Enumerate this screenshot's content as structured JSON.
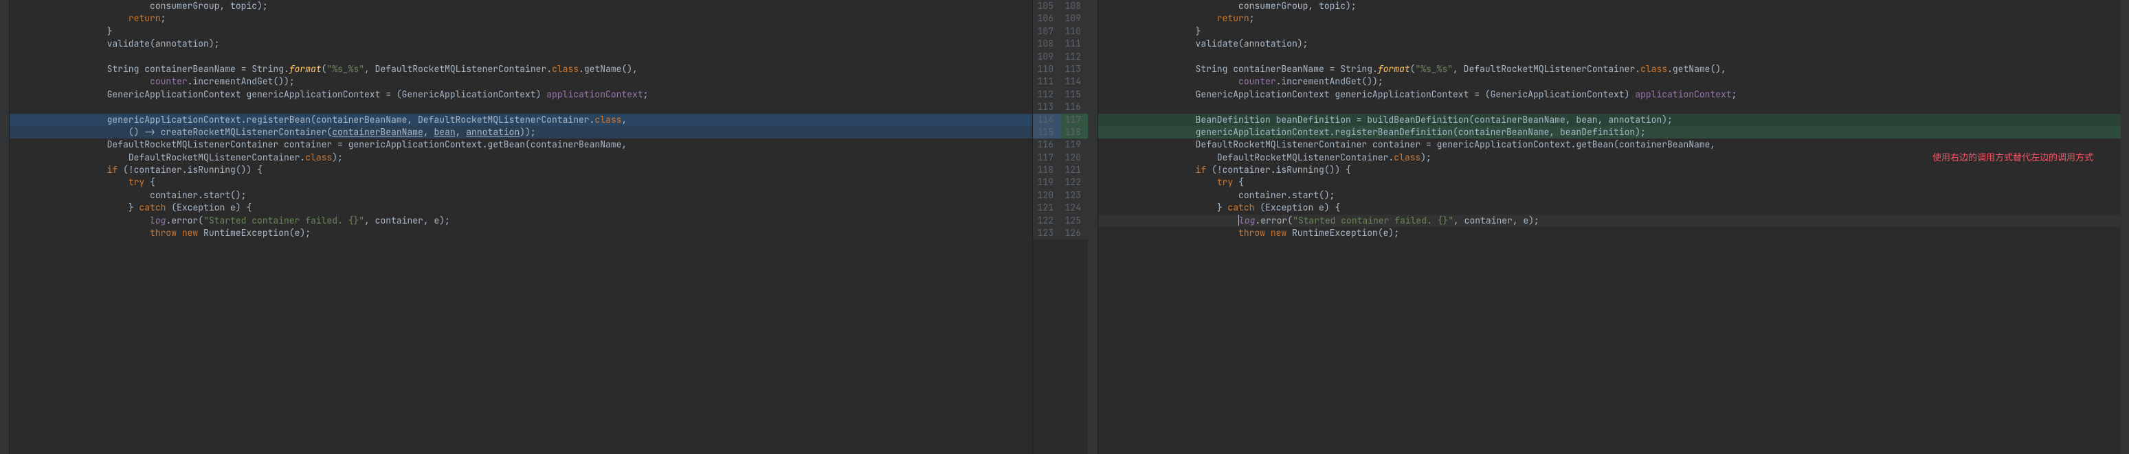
{
  "left": {
    "lines": [
      {
        "num": "",
        "indent": 5,
        "tokens": [
          {
            "t": "consumerGroup",
            "c": "param"
          },
          {
            "t": ", ",
            "c": ""
          },
          {
            "t": "topic",
            "c": "param"
          },
          {
            "t": ");",
            "c": ""
          }
        ]
      },
      {
        "num": "",
        "indent": 4,
        "tokens": [
          {
            "t": "return",
            "c": "kw"
          },
          {
            "t": ";",
            "c": ""
          }
        ]
      },
      {
        "num": "",
        "indent": 3,
        "tokens": [
          {
            "t": "}",
            "c": ""
          }
        ]
      },
      {
        "num": "",
        "indent": 3,
        "tokens": [
          {
            "t": "validate(annotation);",
            "c": ""
          }
        ]
      },
      {
        "num": "",
        "indent": 0,
        "tokens": []
      },
      {
        "num": "",
        "indent": 3,
        "tokens": [
          {
            "t": "String containerBeanName = String.",
            "c": ""
          },
          {
            "t": "format",
            "c": "method-italic"
          },
          {
            "t": "(",
            "c": ""
          },
          {
            "t": "\"%s_%s\"",
            "c": "str"
          },
          {
            "t": ", DefaultRocketMQListenerContainer.",
            "c": ""
          },
          {
            "t": "class",
            "c": "kw"
          },
          {
            "t": ".getName(),",
            "c": ""
          }
        ]
      },
      {
        "num": "",
        "indent": 5,
        "tokens": [
          {
            "t": "counter",
            "c": "field"
          },
          {
            "t": ".incrementAndGet());",
            "c": ""
          }
        ]
      },
      {
        "num": "",
        "indent": 3,
        "tokens": [
          {
            "t": "GenericApplicationContext genericApplicationContext = (GenericApplicationContext) ",
            "c": ""
          },
          {
            "t": "applicationContext",
            "c": "field"
          },
          {
            "t": ";",
            "c": ""
          }
        ]
      },
      {
        "num": "",
        "indent": 0,
        "tokens": []
      },
      {
        "num": "",
        "indent": 3,
        "hl": "blue",
        "tokens": [
          {
            "t": "genericApplicationContext.registerBean(containerBeanName, DefaultRocketMQListenerContainer.",
            "c": ""
          },
          {
            "t": "class",
            "c": "kw"
          },
          {
            "t": ",",
            "c": ""
          }
        ]
      },
      {
        "num": "",
        "indent": 4,
        "hl": "blue-dark",
        "tokens": [
          {
            "t": "() -> createRocketMQListenerContainer(",
            "c": ""
          },
          {
            "t": "containerBeanName",
            "c": "underline"
          },
          {
            "t": ", ",
            "c": ""
          },
          {
            "t": "bean",
            "c": "underline"
          },
          {
            "t": ", ",
            "c": ""
          },
          {
            "t": "annotation",
            "c": "underline"
          },
          {
            "t": "));",
            "c": ""
          }
        ]
      },
      {
        "num": "",
        "indent": 3,
        "tokens": [
          {
            "t": "DefaultRocketMQListenerContainer container = genericApplicationContext.getBean(containerBeanName,",
            "c": ""
          }
        ]
      },
      {
        "num": "",
        "indent": 4,
        "tokens": [
          {
            "t": "DefaultRocketMQListenerContainer.",
            "c": ""
          },
          {
            "t": "class",
            "c": "kw"
          },
          {
            "t": ");",
            "c": ""
          }
        ]
      },
      {
        "num": "",
        "indent": 3,
        "tokens": [
          {
            "t": "if",
            "c": "kw"
          },
          {
            "t": " (!container.isRunning()) {",
            "c": ""
          }
        ]
      },
      {
        "num": "",
        "indent": 4,
        "tokens": [
          {
            "t": "try",
            "c": "kw"
          },
          {
            "t": " {",
            "c": ""
          }
        ]
      },
      {
        "num": "",
        "indent": 5,
        "tokens": [
          {
            "t": "container.start();",
            "c": ""
          }
        ]
      },
      {
        "num": "",
        "indent": 4,
        "tokens": [
          {
            "t": "} ",
            "c": ""
          },
          {
            "t": "catch",
            "c": "kw"
          },
          {
            "t": " (Exception e) {",
            "c": ""
          }
        ]
      },
      {
        "num": "",
        "indent": 5,
        "tokens": [
          {
            "t": "log",
            "c": "field-italic"
          },
          {
            "t": ".error(",
            "c": ""
          },
          {
            "t": "\"Started container failed. {}\"",
            "c": "str"
          },
          {
            "t": ", container, e);",
            "c": ""
          }
        ]
      },
      {
        "num": "",
        "indent": 5,
        "tokens": [
          {
            "t": "throw new",
            "c": "kw"
          },
          {
            "t": " RuntimeException(e);",
            "c": ""
          }
        ]
      }
    ]
  },
  "right": {
    "lines": [
      {
        "indent": 5,
        "tokens": [
          {
            "t": "consumerGroup",
            "c": "param"
          },
          {
            "t": ", ",
            "c": ""
          },
          {
            "t": "topic",
            "c": "param"
          },
          {
            "t": ");",
            "c": ""
          }
        ]
      },
      {
        "indent": 4,
        "tokens": [
          {
            "t": "return",
            "c": "kw"
          },
          {
            "t": ";",
            "c": ""
          }
        ]
      },
      {
        "indent": 3,
        "tokens": [
          {
            "t": "}",
            "c": ""
          }
        ]
      },
      {
        "indent": 3,
        "tokens": [
          {
            "t": "validate(annotation);",
            "c": ""
          }
        ]
      },
      {
        "indent": 0,
        "tokens": []
      },
      {
        "indent": 3,
        "tokens": [
          {
            "t": "String containerBeanName = String.",
            "c": ""
          },
          {
            "t": "format",
            "c": "method-italic"
          },
          {
            "t": "(",
            "c": ""
          },
          {
            "t": "\"%s_%s\"",
            "c": "str"
          },
          {
            "t": ", DefaultRocketMQListenerContainer.",
            "c": ""
          },
          {
            "t": "class",
            "c": "kw"
          },
          {
            "t": ".getName(),",
            "c": ""
          }
        ]
      },
      {
        "indent": 5,
        "tokens": [
          {
            "t": "counter",
            "c": "field"
          },
          {
            "t": ".incrementAndGet());",
            "c": ""
          }
        ]
      },
      {
        "indent": 3,
        "tokens": [
          {
            "t": "GenericApplicationContext genericApplicationContext = (GenericApplicationContext) ",
            "c": ""
          },
          {
            "t": "applicationContext",
            "c": "field"
          },
          {
            "t": ";",
            "c": ""
          }
        ]
      },
      {
        "indent": 0,
        "tokens": []
      },
      {
        "indent": 3,
        "hl": "green",
        "tokens": [
          {
            "t": "BeanDefinition beanDefinition = buildBeanDefinition(containerBeanName, bean, annotation);",
            "c": ""
          }
        ]
      },
      {
        "indent": 3,
        "hl": "green-light",
        "tokens": [
          {
            "t": "genericApplicationContext.registerBeanDefinition(containerBeanName, beanDefinition);",
            "c": ""
          }
        ]
      },
      {
        "indent": 3,
        "tokens": [
          {
            "t": "DefaultRocketMQListenerContainer container = genericApplicationContext.getBean(containerBeanName,",
            "c": ""
          }
        ]
      },
      {
        "indent": 4,
        "tokens": [
          {
            "t": "DefaultRocketMQListenerContainer.",
            "c": ""
          },
          {
            "t": "class",
            "c": "kw"
          },
          {
            "t": ");",
            "c": ""
          }
        ],
        "overlay": "使用右边的调用方式替代左边的调用方式"
      },
      {
        "indent": 3,
        "tokens": [
          {
            "t": "if",
            "c": "kw"
          },
          {
            "t": " (!container.isRunning()) {",
            "c": ""
          }
        ]
      },
      {
        "indent": 4,
        "tokens": [
          {
            "t": "try",
            "c": "kw"
          },
          {
            "t": " {",
            "c": ""
          }
        ]
      },
      {
        "indent": 5,
        "tokens": [
          {
            "t": "container.start();",
            "c": ""
          }
        ]
      },
      {
        "indent": 4,
        "tokens": [
          {
            "t": "} ",
            "c": ""
          },
          {
            "t": "catch",
            "c": "kw"
          },
          {
            "t": " (Exception e) {",
            "c": ""
          }
        ]
      },
      {
        "indent": 5,
        "cursor": true,
        "tokens": [
          {
            "t": "log",
            "c": "field-italic"
          },
          {
            "t": ".error(",
            "c": ""
          },
          {
            "t": "\"Started container failed. {}\"",
            "c": "str"
          },
          {
            "t": ", container, e);",
            "c": ""
          }
        ]
      },
      {
        "indent": 5,
        "tokens": [
          {
            "t": "throw new",
            "c": "kw"
          },
          {
            "t": " RuntimeException(e);",
            "c": ""
          }
        ]
      }
    ]
  },
  "gutters": {
    "left": [
      "105",
      "106",
      "107",
      "108",
      "109",
      "110",
      "111",
      "112",
      "113",
      "114",
      "115",
      "116",
      "117",
      "118",
      "119",
      "120",
      "121",
      "122",
      "123"
    ],
    "right": [
      "108",
      "109",
      "110",
      "111",
      "112",
      "113",
      "114",
      "115",
      "116",
      "117",
      "118",
      "119",
      "120",
      "121",
      "122",
      "123",
      "124",
      "125",
      "126"
    ]
  },
  "annotation_text": "使用右边的调用方式替代左边的调用方式"
}
